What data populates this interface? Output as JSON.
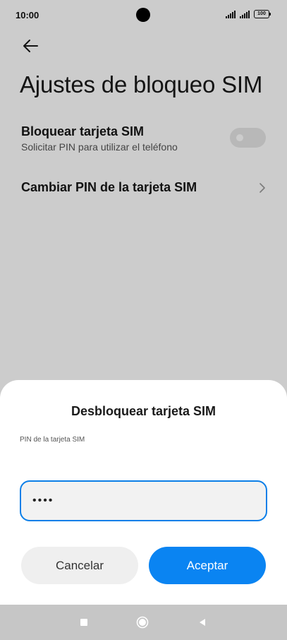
{
  "status_bar": {
    "time": "10:00",
    "battery": "100"
  },
  "settings": {
    "title": "Ajustes de bloqueo SIM",
    "lock_sim": {
      "title": "Bloquear tarjeta SIM",
      "subtitle": "Solicitar PIN para utilizar el teléfono",
      "enabled": false
    },
    "change_pin": {
      "title": "Cambiar PIN de la tarjeta SIM"
    }
  },
  "dialog": {
    "title": "Desbloquear tarjeta SIM",
    "label": "PIN de la tarjeta SIM",
    "pin_value": "••••",
    "cancel_label": "Cancelar",
    "accept_label": "Aceptar"
  },
  "colors": {
    "accent": "#0a84f2",
    "input_border": "#0c7fe8",
    "nav_bar": "#c6c6c6"
  },
  "icons": {
    "back": "arrow-left-icon",
    "chevron": "chevron-right-icon",
    "nav_recents": "square-icon",
    "nav_home": "circle-icon",
    "nav_back": "triangle-left-icon"
  }
}
